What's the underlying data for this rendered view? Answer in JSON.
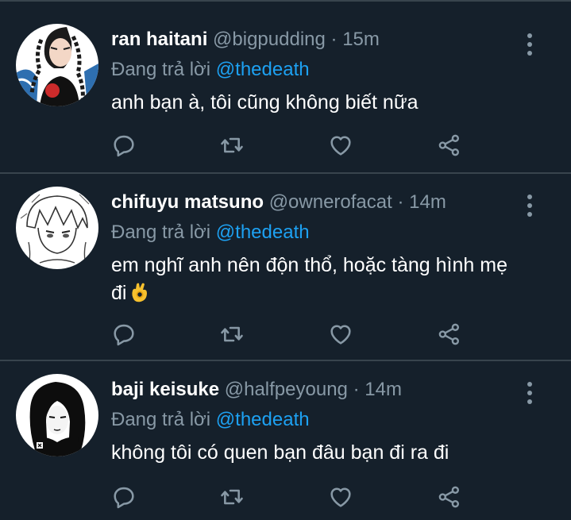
{
  "reply_prefix": "Đang trả lời",
  "icons": {
    "reply": "speech-bubble-icon",
    "retweet": "retweet-arrows-icon",
    "like": "heart-icon",
    "share": "share-icon",
    "menu": "more-vertical-icon"
  },
  "colors": {
    "background": "#15202b",
    "muted": "#8899a6",
    "accent": "#1da1f2",
    "divider": "#38444d"
  },
  "tweets": [
    {
      "name": "ran haitani",
      "handle": "@bigpudding",
      "separator": "·",
      "time": "15m",
      "reply_to": "@thedeath",
      "text": "anh bạn à, tôi cũng không biết nữa"
    },
    {
      "name": "chifuyu matsuno",
      "handle": "@ownerofacat",
      "separator": "·",
      "time": "14m",
      "reply_to": "@thedeath",
      "text": "em nghĩ anh nên độn thổ, hoặc tàng hình mẹ đi",
      "emoji": "ok-hand-emoji"
    },
    {
      "name": "baji keisuke",
      "handle": "@halfpeyoung",
      "separator": "·",
      "time": "14m",
      "reply_to": "@thedeath",
      "text": "không tôi có quen bạn đâu bạn đi ra đi"
    }
  ]
}
